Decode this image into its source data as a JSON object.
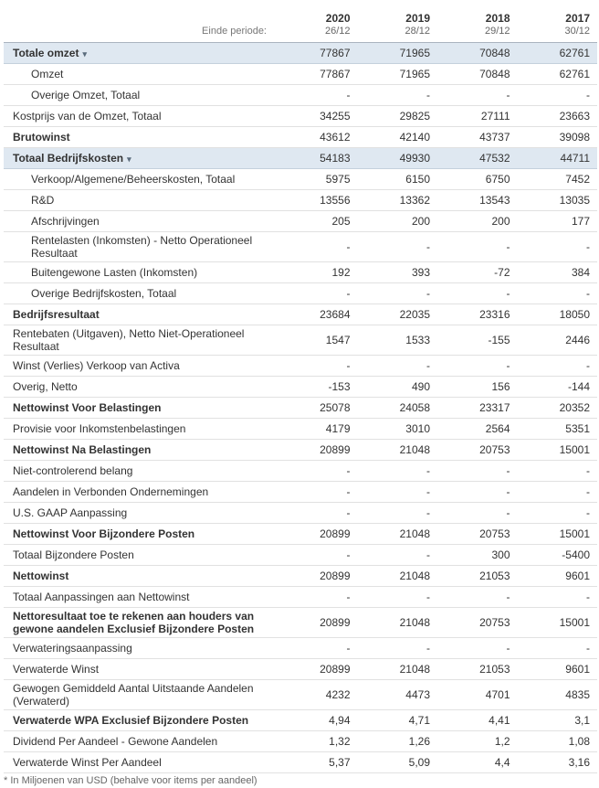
{
  "header": {
    "period_label": "Einde periode:",
    "columns": [
      {
        "year": "2020",
        "date": "26/12"
      },
      {
        "year": "2019",
        "date": "28/12"
      },
      {
        "year": "2018",
        "date": "29/12"
      },
      {
        "year": "2017",
        "date": "30/12"
      }
    ]
  },
  "rows": [
    {
      "label": "Totale omzet",
      "style": "group",
      "expandable": true,
      "values": [
        "77867",
        "71965",
        "70848",
        "62761"
      ]
    },
    {
      "label": "Omzet",
      "style": "indent",
      "values": [
        "77867",
        "71965",
        "70848",
        "62761"
      ]
    },
    {
      "label": "Overige Omzet, Totaal",
      "style": "indent",
      "values": [
        "-",
        "-",
        "-",
        "-"
      ]
    },
    {
      "label": "Kostprijs van de Omzet, Totaal",
      "style": "normal",
      "values": [
        "34255",
        "29825",
        "27111",
        "23663"
      ]
    },
    {
      "label": "Brutowinst",
      "style": "bold",
      "values": [
        "43612",
        "42140",
        "43737",
        "39098"
      ]
    },
    {
      "label": "Totaal Bedrijfskosten",
      "style": "group",
      "expandable": true,
      "values": [
        "54183",
        "49930",
        "47532",
        "44711"
      ]
    },
    {
      "label": "Verkoop/Algemene/Beheerskosten, Totaal",
      "style": "indent",
      "values": [
        "5975",
        "6150",
        "6750",
        "7452"
      ]
    },
    {
      "label": "R&D",
      "style": "indent",
      "values": [
        "13556",
        "13362",
        "13543",
        "13035"
      ]
    },
    {
      "label": "Afschrijvingen",
      "style": "indent",
      "values": [
        "205",
        "200",
        "200",
        "177"
      ]
    },
    {
      "label": "Rentelasten (Inkomsten) - Netto Operationeel Resultaat",
      "style": "indent",
      "tall": true,
      "values": [
        "-",
        "-",
        "-",
        "-"
      ]
    },
    {
      "label": "Buitengewone Lasten (Inkomsten)",
      "style": "indent",
      "values": [
        "192",
        "393",
        "-72",
        "384"
      ]
    },
    {
      "label": "Overige Bedrijfskosten, Totaal",
      "style": "indent",
      "values": [
        "-",
        "-",
        "-",
        "-"
      ]
    },
    {
      "label": "Bedrijfsresultaat",
      "style": "bold",
      "values": [
        "23684",
        "22035",
        "23316",
        "18050"
      ]
    },
    {
      "label": "Rentebaten (Uitgaven), Netto Niet-Operationeel Resultaat",
      "style": "normal",
      "tall": true,
      "values": [
        "1547",
        "1533",
        "-155",
        "2446"
      ]
    },
    {
      "label": "Winst (Verlies) Verkoop van Activa",
      "style": "normal",
      "values": [
        "-",
        "-",
        "-",
        "-"
      ]
    },
    {
      "label": "Overig, Netto",
      "style": "normal",
      "values": [
        "-153",
        "490",
        "156",
        "-144"
      ]
    },
    {
      "label": "Nettowinst Voor Belastingen",
      "style": "bold",
      "values": [
        "25078",
        "24058",
        "23317",
        "20352"
      ]
    },
    {
      "label": "Provisie voor Inkomstenbelastingen",
      "style": "normal",
      "values": [
        "4179",
        "3010",
        "2564",
        "5351"
      ]
    },
    {
      "label": "Nettowinst Na Belastingen",
      "style": "bold",
      "values": [
        "20899",
        "21048",
        "20753",
        "15001"
      ]
    },
    {
      "label": "Niet-controlerend belang",
      "style": "normal",
      "values": [
        "-",
        "-",
        "-",
        "-"
      ]
    },
    {
      "label": "Aandelen in Verbonden Ondernemingen",
      "style": "normal",
      "values": [
        "-",
        "-",
        "-",
        "-"
      ]
    },
    {
      "label": "U.S. GAAP Aanpassing",
      "style": "normal",
      "values": [
        "-",
        "-",
        "-",
        "-"
      ]
    },
    {
      "label": "Nettowinst Voor Bijzondere Posten",
      "style": "bold",
      "values": [
        "20899",
        "21048",
        "20753",
        "15001"
      ]
    },
    {
      "label": "Totaal Bijzondere Posten",
      "style": "normal",
      "values": [
        "-",
        "-",
        "300",
        "-5400"
      ]
    },
    {
      "label": "Nettowinst",
      "style": "bold",
      "values": [
        "20899",
        "21048",
        "21053",
        "9601"
      ]
    },
    {
      "label": "Totaal Aanpassingen aan Nettowinst",
      "style": "normal",
      "values": [
        "-",
        "-",
        "-",
        "-"
      ]
    },
    {
      "label": "Nettoresultaat toe te rekenen aan houders van gewone aandelen Exclusief Bijzondere Posten",
      "style": "bold",
      "tall": true,
      "values": [
        "20899",
        "21048",
        "20753",
        "15001"
      ]
    },
    {
      "label": "Verwateringsaanpassing",
      "style": "normal",
      "values": [
        "-",
        "-",
        "-",
        "-"
      ]
    },
    {
      "label": "Verwaterde Winst",
      "style": "normal",
      "values": [
        "20899",
        "21048",
        "21053",
        "9601"
      ]
    },
    {
      "label": "Gewogen Gemiddeld Aantal Uitstaande Aandelen (Verwaterd)",
      "style": "normal",
      "tall": true,
      "values": [
        "4232",
        "4473",
        "4701",
        "4835"
      ]
    },
    {
      "label": "Verwaterde WPA Exclusief Bijzondere Posten",
      "style": "bold",
      "values": [
        "4,94",
        "4,71",
        "4,41",
        "3,1"
      ]
    },
    {
      "label": "Dividend Per Aandeel - Gewone Aandelen",
      "style": "normal",
      "values": [
        "1,32",
        "1,26",
        "1,2",
        "1,08"
      ]
    },
    {
      "label": "Verwaterde Winst Per Aandeel",
      "style": "normal",
      "values": [
        "5,37",
        "5,09",
        "4,4",
        "3,16"
      ]
    }
  ],
  "footnote": "* In Miljoenen van USD (behalve voor items per aandeel)",
  "icons": {
    "expand": "chevron-down-icon"
  }
}
